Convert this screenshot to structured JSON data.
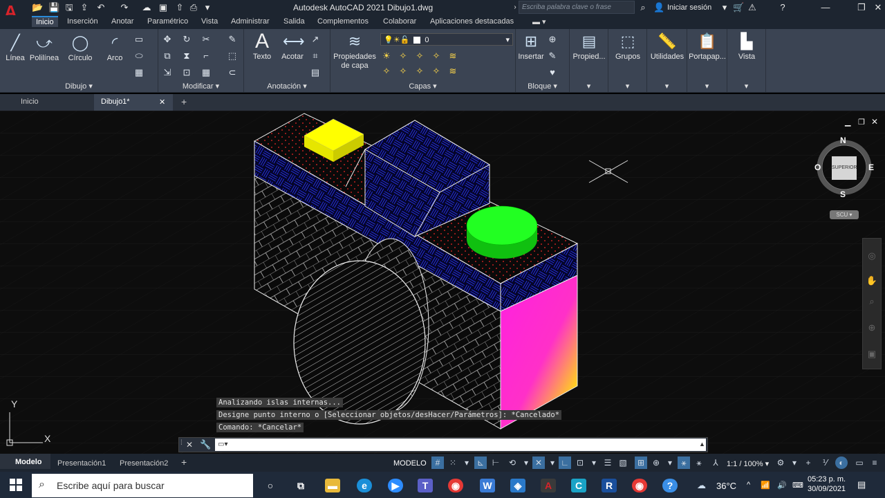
{
  "titlebar": {
    "title": "Autodesk AutoCAD 2021    Dibujo1.dwg",
    "search_placeholder": "Escriba palabra clave o frase",
    "signin": "Iniciar sesión",
    "logo": "A"
  },
  "ribbon_tabs": [
    "Inicio",
    "Inserción",
    "Anotar",
    "Paramétrico",
    "Vista",
    "Administrar",
    "Salida",
    "Complementos",
    "Colaborar",
    "Aplicaciones destacadas"
  ],
  "panels": {
    "dibujo": {
      "label": "Dibujo",
      "tools": [
        "Línea",
        "Polilínea",
        "Círculo",
        "Arco"
      ]
    },
    "modificar": {
      "label": "Modificar"
    },
    "anotacion": {
      "label": "Anotación",
      "tools": [
        "Texto",
        "Acotar"
      ]
    },
    "capas": {
      "label": "Capas",
      "props_line1": "Propiedades",
      "props_line2": "de capa",
      "layer_value": "0"
    },
    "bloque": {
      "label": "Bloque",
      "tool": "Insertar"
    },
    "propiedades": {
      "label": "Propied..."
    },
    "grupos": {
      "label": "Grupos"
    },
    "utilidades": {
      "label": "Utilidades"
    },
    "portapapeles": {
      "label": "Portapap..."
    },
    "vista": {
      "label": "Vista"
    }
  },
  "doc_tabs": [
    "Inicio",
    "Dibujo1*"
  ],
  "viewcube": {
    "north": "N",
    "south": "S",
    "east": "E",
    "west": "O",
    "face": "SUPERIOR",
    "wcs": "SCU"
  },
  "command": {
    "history": [
      "Analizando islas internas...",
      "Designe punto interno o [Seleccionar objetos/desHacer/Parámetros]: *Cancelado*",
      "Comando: *Cancelar*"
    ],
    "input_value": ""
  },
  "status": {
    "layout_tabs": [
      "Modelo",
      "Presentación1",
      "Presentación2"
    ],
    "mode": "MODELO",
    "scale": "1:1 / 100%"
  },
  "taskbar": {
    "search_placeholder": "Escribe aquí para buscar",
    "weather": "36°C",
    "time": "05:23 p. m.",
    "date": "30/09/2021"
  },
  "ucs": {
    "x": "X",
    "y": "Y"
  },
  "colors": {
    "ribbon": "#3b4453",
    "accent": "#2a8bd9",
    "hatch_blue": "#1e2bd8",
    "magenta": "#ff22dd",
    "yellow": "#ffff00",
    "green": "#11ee11"
  }
}
